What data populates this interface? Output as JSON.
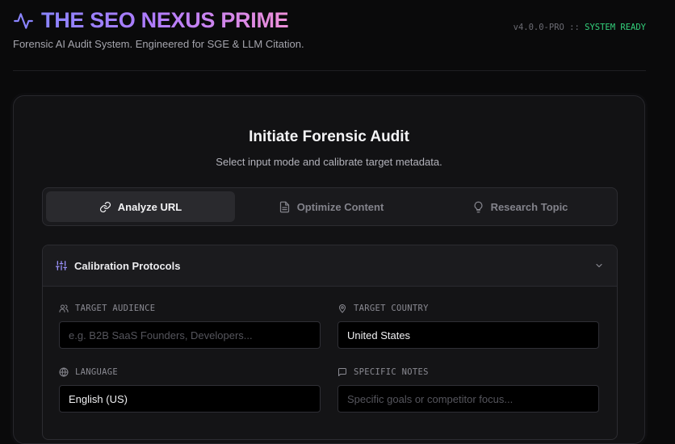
{
  "header": {
    "title": "THE SEO NEXUS PRIME",
    "subtitle": "Forensic AI Audit System. Engineered for SGE & LLM Citation.",
    "version": "v4.0.0-PRO ::",
    "status": "SYSTEM READY",
    "logo_icon": "activity-pulse-icon"
  },
  "card": {
    "title": "Initiate Forensic Audit",
    "subtitle": "Select input mode and calibrate target metadata."
  },
  "tabs": [
    {
      "label": "Analyze URL",
      "icon": "link-icon",
      "active": true
    },
    {
      "label": "Optimize Content",
      "icon": "document-icon",
      "active": false
    },
    {
      "label": "Research Topic",
      "icon": "lightbulb-icon",
      "active": false
    }
  ],
  "calibration": {
    "title": "Calibration Protocols",
    "fields": {
      "audience": {
        "label": "TARGET AUDIENCE",
        "placeholder": "e.g. B2B SaaS Founders, Developers...",
        "value": ""
      },
      "country": {
        "label": "TARGET COUNTRY",
        "placeholder": "",
        "value": "United States"
      },
      "language": {
        "label": "LANGUAGE",
        "placeholder": "",
        "value": "English (US)"
      },
      "notes": {
        "label": "SPECIFIC NOTES",
        "placeholder": "Specific goals or competitor focus...",
        "value": ""
      }
    }
  },
  "colors": {
    "accent_start": "#8a84ff",
    "accent_end": "#ee8fd8",
    "status_green": "#34d17c",
    "background": "#0a0a0b"
  }
}
